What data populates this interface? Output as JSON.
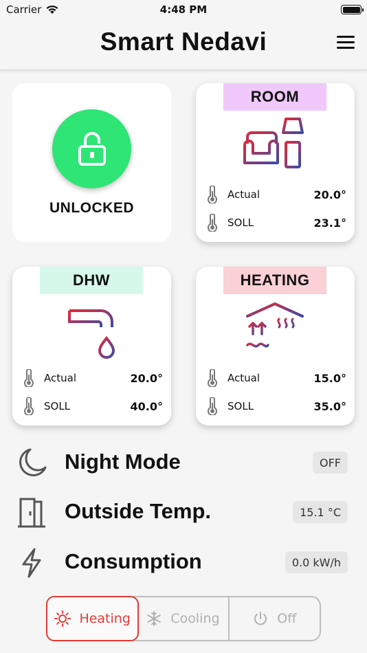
{
  "status_bar": {
    "carrier": "Carrier",
    "time": "4:48 PM"
  },
  "header": {
    "title": "Smart Nedavi"
  },
  "lock": {
    "label": "UNLOCKED",
    "color": "#2ee576"
  },
  "zones": [
    {
      "name": "ROOM",
      "tag_color": "#f1c8fb",
      "actual_label": "Actual",
      "actual": "20.0°",
      "soll_label": "SOLL",
      "soll": "23.1°"
    },
    {
      "name": "DHW",
      "tag_color": "#d6f8ea",
      "actual_label": "Actual",
      "actual": "20.0°",
      "soll_label": "SOLL",
      "soll": "40.0°"
    },
    {
      "name": "HEATING",
      "tag_color": "#fbd0d6",
      "actual_label": "Actual",
      "actual": "15.0°",
      "soll_label": "SOLL",
      "soll": "35.0°"
    }
  ],
  "info": {
    "night_mode": {
      "title": "Night Mode",
      "value": "OFF",
      "icon": "moon-icon"
    },
    "outside_temp": {
      "title": "Outside Temp.",
      "value": "15.1 °C",
      "icon": "door-icon"
    },
    "consumption": {
      "title": "Consumption",
      "value": "0.0 kW/h",
      "icon": "lightning-icon"
    }
  },
  "modes": {
    "heating": "Heating",
    "cooling": "Cooling",
    "off": "Off",
    "selected": "heating",
    "accent": "#e53935"
  }
}
